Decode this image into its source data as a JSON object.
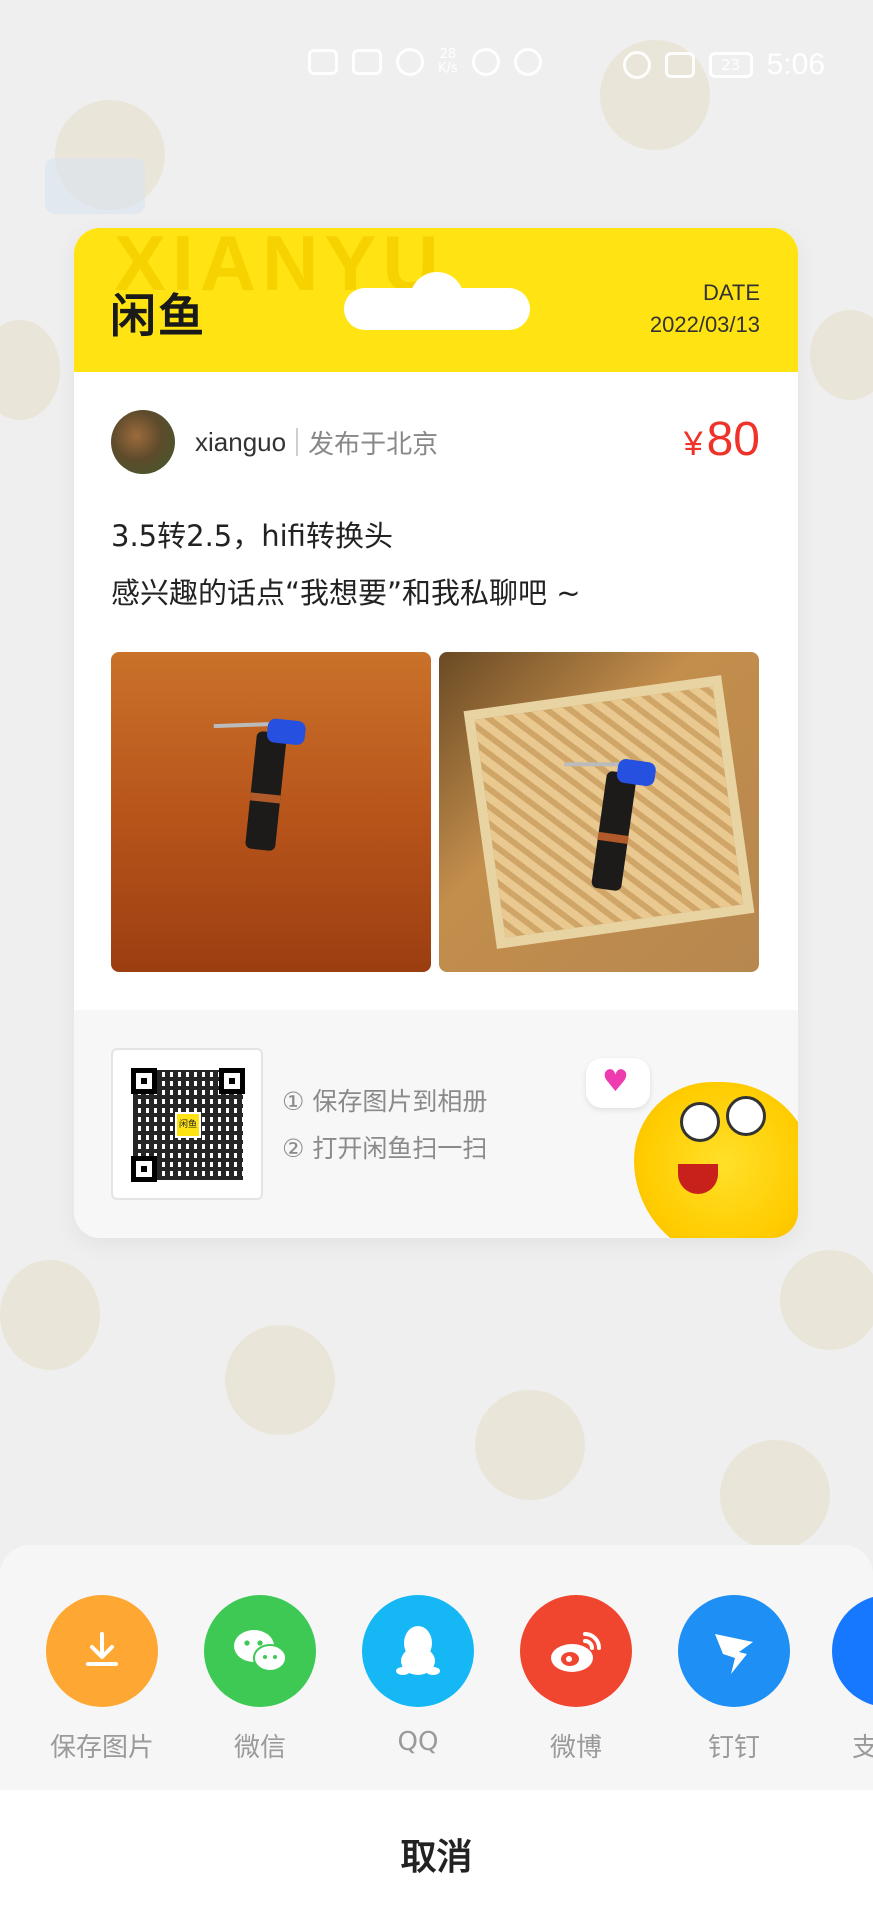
{
  "status_bar": {
    "network_speed": "28\nK/s",
    "battery": "23",
    "time": "5:06"
  },
  "card": {
    "brand_logo": "闲鱼",
    "header_watermark": "XIANYU",
    "date_label": "DATE",
    "date_value": "2022/03/13",
    "username": "xianguo",
    "location": "发布于北京",
    "currency": "¥",
    "price": "80",
    "description_line1": "3.5转2.5，hifi转换头",
    "description_line2": "感兴趣的话点“我想要”和我私聊吧 ~",
    "qr_logo": "闲鱼",
    "step1": "① 保存图片到相册",
    "step2": "② 打开闲鱼扫一扫"
  },
  "share_sheet": {
    "items": [
      {
        "label": "保存图片",
        "icon": "download-icon",
        "color": "#ffa733"
      },
      {
        "label": "微信",
        "icon": "wechat-icon",
        "color": "#3ec955"
      },
      {
        "label": "QQ",
        "icon": "qq-penguin-icon",
        "color": "#15b8f5"
      },
      {
        "label": "微博",
        "icon": "weibo-icon",
        "color": "#f0462f"
      },
      {
        "label": "钉钉",
        "icon": "dingtalk-icon",
        "color": "#1d8ff5"
      },
      {
        "label": "支",
        "icon": "alipay-icon",
        "color": "#1677ff"
      }
    ],
    "cancel_label": "取消"
  }
}
